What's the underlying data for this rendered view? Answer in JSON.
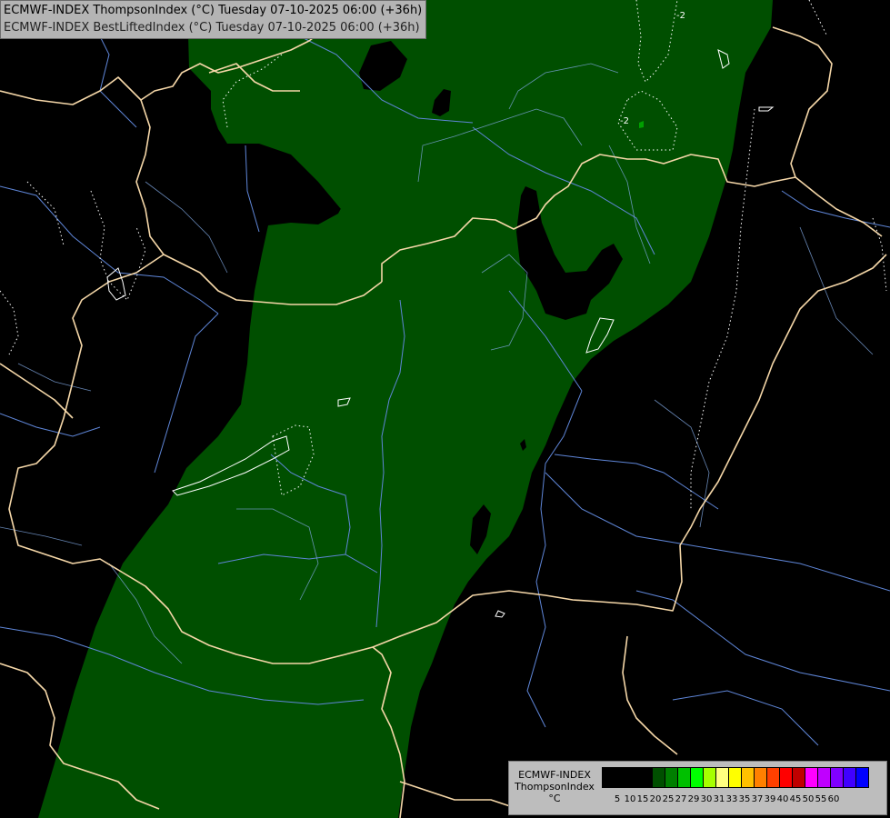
{
  "titles": {
    "line1": "ECMWF-INDEX ThompsonIndex (°C) Tuesday 07-10-2025 06:00 (+36h)",
    "line2": "ECMWF-INDEX BestLiftedIndex (°C) Tuesday 07-10-2025 06:00 (+36h)"
  },
  "legend": {
    "model": "ECMWF-INDEX",
    "parameter": "ThompsonIndex",
    "unit": "°C",
    "colors": [
      "#000000",
      "#000000",
      "#000000",
      "#000000",
      "#004f00",
      "#007f00",
      "#00c000",
      "#00ff00",
      "#a6ff00",
      "#ffff80",
      "#ffff00",
      "#ffc000",
      "#ff8000",
      "#ff4000",
      "#ff0000",
      "#c00000",
      "#ff00ff",
      "#c000ff",
      "#8000ff",
      "#4000ff",
      "#0000ff"
    ],
    "tick_labels": [
      "5",
      "10",
      "15",
      "20",
      "25",
      "27",
      "29",
      "30",
      "31",
      "33",
      "35",
      "37",
      "39",
      "40",
      "45",
      "50",
      "55",
      "60"
    ]
  },
  "map_colors": {
    "background": "#000000",
    "field_20_25": "#004f00",
    "field_25_27": "#007f00",
    "country_borders": "#f5d7a8",
    "rivers": "#5f86d8",
    "regions": "#7fa6e0",
    "lifted_index_contours": "#ffffff"
  },
  "contour_labels": [
    "-2",
    "-2"
  ]
}
